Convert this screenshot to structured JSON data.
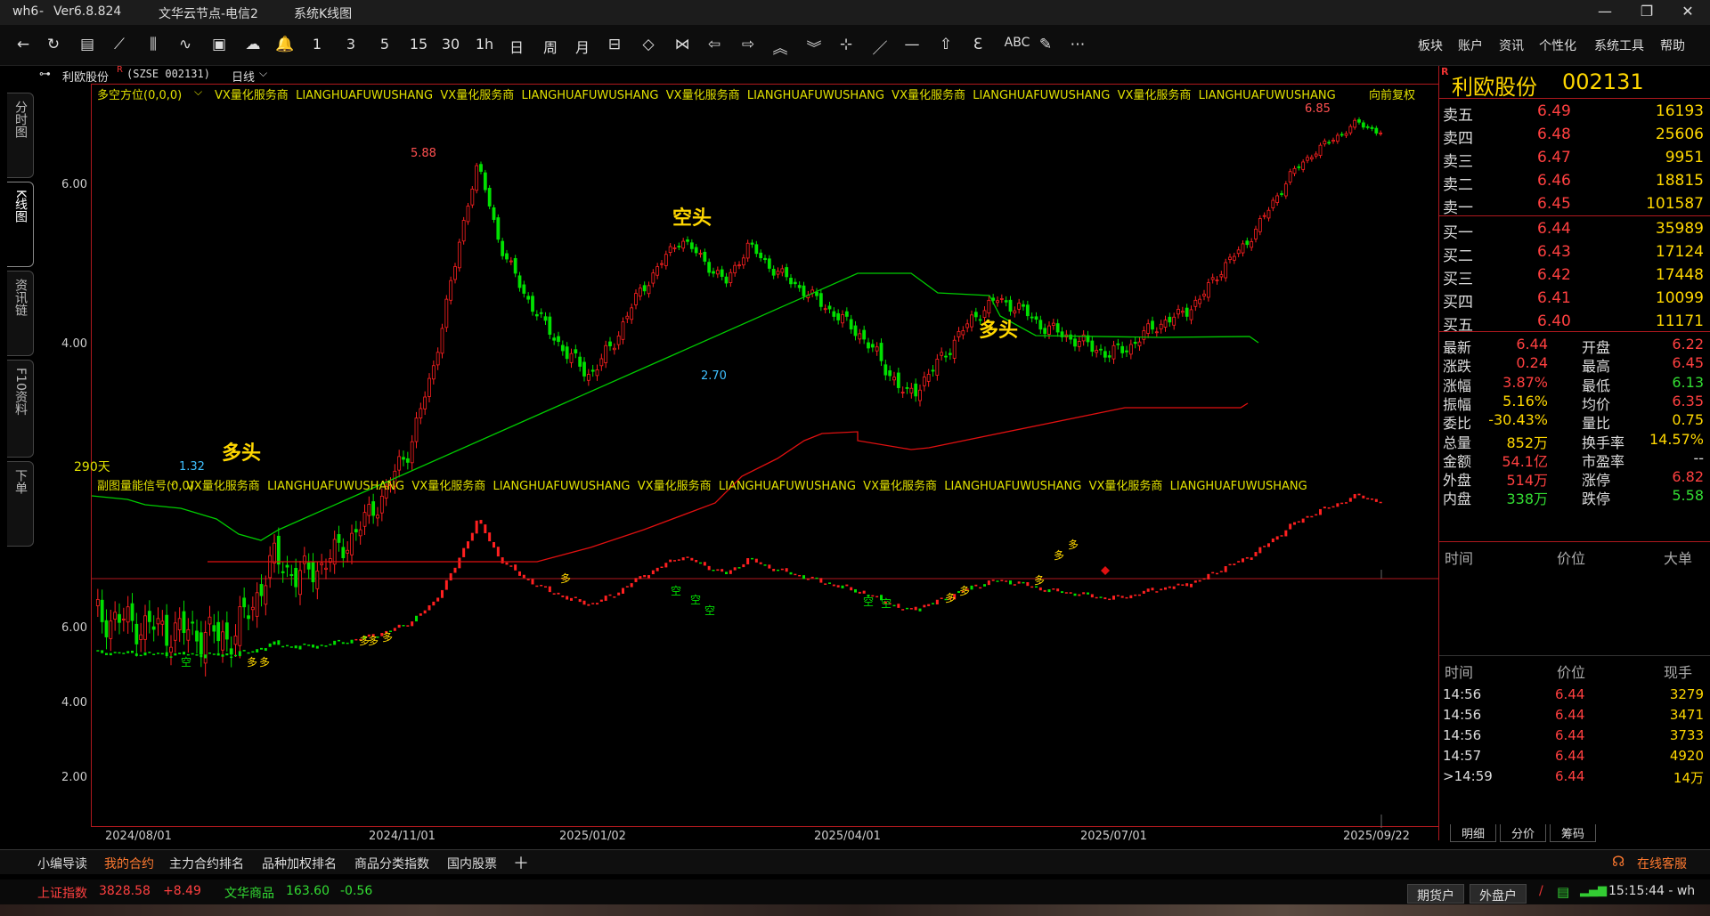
{
  "titlebar": {
    "app": "wh6",
    "version": "Ver6.8.824",
    "server": "文华云节点-电信2",
    "view": "系统K线图"
  },
  "toolbar": {
    "periods": [
      "1",
      "3",
      "5",
      "15",
      "30",
      "1h",
      "日",
      "周",
      "月"
    ],
    "menus": [
      "板块",
      "账户",
      "资讯",
      "个性化",
      "系统工具",
      "帮助"
    ]
  },
  "symbar": {
    "name": "利欧股份",
    "superscript": "R",
    "code": "(SZSE 002131)",
    "period": "日线"
  },
  "left_tabs": [
    "分时图",
    "K线图",
    "资讯链",
    "F10资料",
    "下单"
  ],
  "main_indicator": {
    "name": "多空方位(0,0,0)",
    "ads": [
      "VX量化服务商",
      "LIANGHUAFUWUSHANG",
      "VX量化服务商",
      "LIANGHUAFUWUSHANG",
      "VX量化服务商",
      "LIANGHUAFUWUSHANG",
      "VX量化服务商",
      "LIANGHUAFUWUSHANG",
      "VX量化服务商",
      "LIANGHUAFUWUSHANG"
    ],
    "adjust": "向前复权",
    "days": "290天"
  },
  "sub_indicator": {
    "name": "副图量能信号(0,0)",
    "ads": [
      "VX量化服务商",
      "LIANGHUAFUWUSHANG",
      "VX量化服务商",
      "LIANGHUAFUWUSHANG",
      "VX量化服务商",
      "LIANGHUAFUWUSHANG",
      "VX量化服务商",
      "LIANGHUAFUWUSHANG",
      "VX量化服务商",
      "LIANGHUAFUWUSHANG"
    ]
  },
  "chart_data": {
    "type": "candlestick",
    "x_ticks": [
      "2024/08/01",
      "2024/11/01",
      "2025/01/02",
      "2025/04/01",
      "2025/07/01",
      "2025/09/22"
    ],
    "main_y_ticks": [
      "6.00",
      "4.00"
    ],
    "sub_y_ticks": [
      "6.00",
      "4.00",
      "2.00"
    ],
    "high_mark": "5.88",
    "low_mark": "1.32",
    "recent_high": "6.85",
    "mid_low": "2.70",
    "annotations": {
      "bear": "空头",
      "bull1": "多头",
      "bull2": "多头"
    },
    "signals": {
      "long": "多",
      "short": "空"
    },
    "close_series": [
      1.42,
      1.4,
      1.38,
      1.36,
      1.35,
      1.34,
      1.32,
      1.45,
      1.7,
      1.6,
      1.65,
      1.75,
      1.9,
      2.1,
      2.4,
      3.0,
      4.2,
      5.8,
      4.5,
      3.9,
      3.5,
      3.2,
      3.0,
      3.3,
      3.8,
      4.2,
      4.6,
      4.3,
      4.0,
      4.5,
      4.2,
      4.0,
      3.8,
      3.6,
      3.4,
      3.1,
      2.8,
      3.0,
      3.3,
      3.6,
      3.8,
      3.7,
      3.5,
      3.4,
      3.3,
      3.2,
      3.3,
      3.5,
      3.6,
      3.8,
      4.2,
      4.5,
      5.0,
      5.6,
      6.0,
      6.3,
      6.6,
      6.4
    ],
    "bear_line_color": "#00cc00",
    "bull_line_color": "#e01010"
  },
  "quote": {
    "name": "利欧股份",
    "code": "002131",
    "asks": [
      {
        "label": "卖五",
        "price": "6.49",
        "vol": "16193"
      },
      {
        "label": "卖四",
        "price": "6.48",
        "vol": "25606"
      },
      {
        "label": "卖三",
        "price": "6.47",
        "vol": "9951"
      },
      {
        "label": "卖二",
        "price": "6.46",
        "vol": "18815"
      },
      {
        "label": "卖一",
        "price": "6.45",
        "vol": "101587"
      }
    ],
    "bids": [
      {
        "label": "买一",
        "price": "6.44",
        "vol": "35989"
      },
      {
        "label": "买二",
        "price": "6.43",
        "vol": "17124"
      },
      {
        "label": "买三",
        "price": "6.42",
        "vol": "17448"
      },
      {
        "label": "买四",
        "price": "6.41",
        "vol": "10099"
      },
      {
        "label": "买五",
        "price": "6.40",
        "vol": "11171"
      }
    ],
    "stats": [
      {
        "l": "最新",
        "v": "6.44",
        "l2": "开盘",
        "v2": "6.22"
      },
      {
        "l": "涨跌",
        "v": "0.24",
        "l2": "最高",
        "v2": "6.45"
      },
      {
        "l": "涨幅",
        "v": "3.87%",
        "l2": "最低",
        "v2": "6.13"
      },
      {
        "l": "振幅",
        "v": "5.16%",
        "l2": "均价",
        "v2": "6.35"
      },
      {
        "l": "委比",
        "v": "-30.43%",
        "l2": "量比",
        "v2": "0.75"
      },
      {
        "l": "总量",
        "v": "852万",
        "l2": "换手率",
        "v2": "14.57%"
      },
      {
        "l": "金额",
        "v": "54.1亿",
        "l2": "市盈率",
        "v2": "--"
      },
      {
        "l": "外盘",
        "v": "514万",
        "l2": "涨停",
        "v2": "6.82"
      },
      {
        "l": "内盘",
        "v": "338万",
        "l2": "跌停",
        "v2": "5.58"
      }
    ],
    "big_header": {
      "a": "时间",
      "b": "价位",
      "c": "大单"
    },
    "ticks_header": {
      "a": "时间",
      "b": "价位",
      "c": "现手"
    },
    "ticks": [
      {
        "t": "14:56",
        "p": "6.44",
        "v": "3279"
      },
      {
        "t": "14:56",
        "p": "6.44",
        "v": "3471"
      },
      {
        "t": "14:56",
        "p": "6.44",
        "v": "3733"
      },
      {
        "t": "14:57",
        "p": "6.44",
        "v": "4920"
      },
      {
        "t": ">14:59",
        "p": "6.44",
        "v": "14万"
      }
    ],
    "tabs": [
      "明细",
      "分价",
      "筹码"
    ]
  },
  "bottom_tabs": [
    "小编导读",
    "我的合约",
    "主力合约排名",
    "品种加权排名",
    "商品分类指数",
    "国内股票"
  ],
  "service": "在线客服",
  "status": {
    "idx1_name": "上证指数",
    "idx1_val": "3828.58",
    "idx1_chg": "+8.49",
    "idx2_name": "文华商品",
    "idx2_val": "163.60",
    "idx2_chg": "-0.56",
    "btn1": "期货户",
    "btn2": "外盘户",
    "time": "15:15:44 - wh"
  }
}
